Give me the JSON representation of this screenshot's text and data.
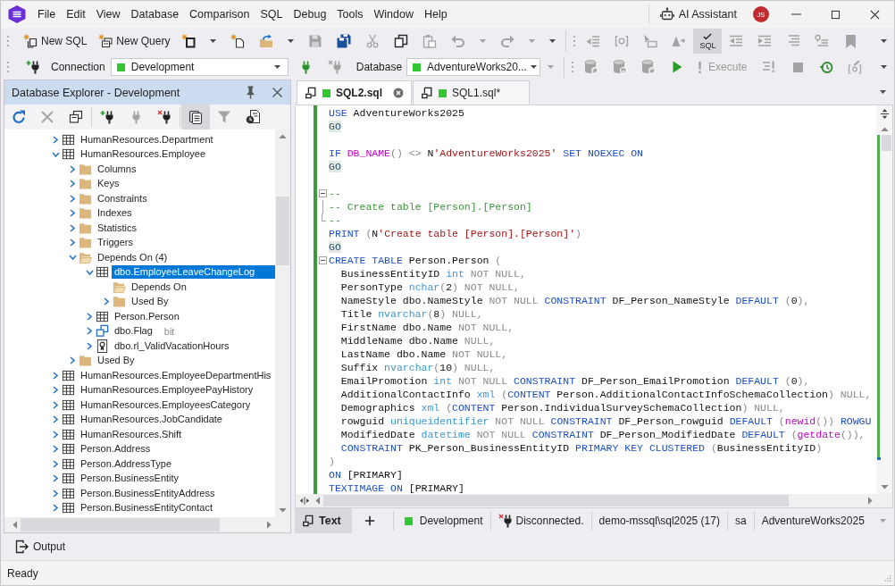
{
  "menu_bar": {
    "items": [
      "File",
      "Edit",
      "View",
      "Database",
      "Comparison",
      "SQL",
      "Debug",
      "Tools",
      "Window",
      "Help"
    ],
    "assistant": "AI Assistant",
    "avatar": "JS"
  },
  "toolbar": {
    "new_sql": {
      "label": "New SQL",
      "disabled": false
    },
    "new_query": {
      "label": "New Query",
      "disabled": false
    },
    "sql_check": {
      "label": "SQL",
      "selected": true
    }
  },
  "connection_bar": {
    "connection_label": "Connection",
    "connection": "Development",
    "database_label": "Database",
    "database": "AdventureWorks20...",
    "execute": {
      "label": "Execute",
      "disabled": true
    }
  },
  "explorer": {
    "title": "Database Explorer - Development",
    "view_toggle": {
      "selected": true
    },
    "tree": [
      {
        "label": "HumanResources.Department",
        "kind": "table",
        "expanded": false,
        "selected": false
      },
      {
        "label": "HumanResources.Employee",
        "kind": "table",
        "expanded": true,
        "selected": false,
        "children": [
          {
            "label": "Columns",
            "kind": "folder",
            "expanded": false,
            "selected": false
          },
          {
            "label": "Keys",
            "kind": "folder",
            "expanded": false,
            "selected": false
          },
          {
            "label": "Constraints",
            "kind": "folder",
            "expanded": false,
            "selected": false
          },
          {
            "label": "Indexes",
            "kind": "folder",
            "expanded": false,
            "selected": false
          },
          {
            "label": "Statistics",
            "kind": "folder",
            "expanded": false,
            "selected": false
          },
          {
            "label": "Triggers",
            "kind": "folder",
            "expanded": false,
            "selected": false
          },
          {
            "label": "Depends On (4)",
            "kind": "folder",
            "expanded": true,
            "selected": false,
            "children": [
              {
                "label": "dbo.EmployeeLeaveChangeLog",
                "kind": "table",
                "expanded": true,
                "selected": true,
                "children": [
                  {
                    "label": "Depends On",
                    "kind": "folder",
                    "expanded": true,
                    "selected": false
                  },
                  {
                    "label": "Used By",
                    "kind": "folder",
                    "expanded": false,
                    "selected": false
                  }
                ]
              },
              {
                "label": "Person.Person",
                "kind": "table",
                "expanded": false,
                "selected": false
              },
              {
                "label": "dbo.Flag",
                "detail": "bit",
                "kind": "type",
                "expanded": false,
                "selected": false
              },
              {
                "label": "dbo.rl_ValidVacationHours",
                "kind": "rule",
                "expanded": false,
                "selected": false
              }
            ]
          },
          {
            "label": "Used By",
            "kind": "folder",
            "expanded": false,
            "selected": false
          }
        ]
      },
      {
        "label": "HumanResources.EmployeeDepartmentHis",
        "kind": "table",
        "expanded": false,
        "selected": false
      },
      {
        "label": "HumanResources.EmployeePayHistory",
        "kind": "table",
        "expanded": false,
        "selected": false
      },
      {
        "label": "HumanResources.EmployeesCategory",
        "kind": "table",
        "expanded": false,
        "selected": false
      },
      {
        "label": "HumanResources.JobCandidate",
        "kind": "table",
        "expanded": false,
        "selected": false
      },
      {
        "label": "HumanResources.Shift",
        "kind": "table",
        "expanded": false,
        "selected": false
      },
      {
        "label": "Person.Address",
        "kind": "table",
        "expanded": false,
        "selected": false
      },
      {
        "label": "Person.AddressType",
        "kind": "table",
        "expanded": false,
        "selected": false
      },
      {
        "label": "Person.BusinessEntity",
        "kind": "table",
        "expanded": false,
        "selected": false
      },
      {
        "label": "Person.BusinessEntityAddress",
        "kind": "table",
        "expanded": false,
        "selected": false
      },
      {
        "label": "Person.BusinessEntityContact",
        "kind": "table",
        "expanded": false,
        "selected": false
      }
    ]
  },
  "editor": {
    "tabs": [
      {
        "label": "SQL2.sql",
        "selected": true
      },
      {
        "label": "SQL1.sql*",
        "selected": false
      }
    ],
    "lines": [
      {
        "tokens": [
          {
            "kind": "keyword",
            "text": "USE"
          },
          {
            "kind": "plain",
            "text": " AdventureWorks2025"
          }
        ]
      },
      {
        "tokens": [
          {
            "kind": "batch",
            "text": "GO"
          }
        ]
      },
      {
        "blank_before": true,
        "tokens": [
          {
            "kind": "keyword",
            "text": "IF"
          },
          {
            "kind": "function",
            "text": " DB_NAME"
          },
          {
            "kind": "operator",
            "text": "()"
          },
          {
            "kind": "operator",
            "text": " <>"
          },
          {
            "kind": "plain",
            "text": " N"
          },
          {
            "kind": "string",
            "text": "'AdventureWorks2025'"
          },
          {
            "kind": "keyword",
            "text": " SET NOEXEC ON"
          }
        ]
      },
      {
        "tokens": [
          {
            "kind": "batch",
            "text": "GO"
          }
        ]
      },
      {
        "blank_before": true,
        "expanded": true,
        "tokens": [
          {
            "kind": "comment",
            "text": "--"
          }
        ]
      },
      {
        "tokens": [
          {
            "kind": "comment",
            "text": "-- Create table [Person].[Person]"
          }
        ]
      },
      {
        "tokens": [
          {
            "kind": "comment",
            "text": "--"
          }
        ]
      },
      {
        "tokens": [
          {
            "kind": "keyword",
            "text": "PRINT"
          },
          {
            "kind": "operator",
            "text": " ("
          },
          {
            "kind": "plain",
            "text": "N"
          },
          {
            "kind": "string",
            "text": "'Create table [Person].[Person]'"
          },
          {
            "kind": "operator",
            "text": ")"
          }
        ]
      },
      {
        "tokens": [
          {
            "kind": "batch",
            "text": "GO"
          }
        ]
      },
      {
        "expanded": true,
        "tokens": [
          {
            "kind": "keyword",
            "text": "CREATE TABLE"
          },
          {
            "kind": "plain",
            "text": " Person.Person"
          },
          {
            "kind": "operator",
            "text": " ("
          }
        ]
      },
      {
        "tokens": [
          {
            "kind": "plain",
            "text": "  BusinessEntityID"
          },
          {
            "kind": "type",
            "text": " int"
          },
          {
            "kind": "operator",
            "text": " NOT NULL,"
          }
        ]
      },
      {
        "tokens": [
          {
            "kind": "plain",
            "text": "  PersonType"
          },
          {
            "kind": "type",
            "text": " nchar"
          },
          {
            "kind": "operator",
            "text": "("
          },
          {
            "kind": "plain",
            "text": "2"
          },
          {
            "kind": "operator",
            "text": ")"
          },
          {
            "kind": "operator",
            "text": " NOT NULL,"
          }
        ]
      },
      {
        "tokens": [
          {
            "kind": "plain",
            "text": "  NameStyle dbo.NameStyle"
          },
          {
            "kind": "operator",
            "text": " NOT NULL"
          },
          {
            "kind": "keyword",
            "text": " CONSTRAINT"
          },
          {
            "kind": "plain",
            "text": " DF_Person_NameStyle"
          },
          {
            "kind": "keyword",
            "text": " DEFAULT"
          },
          {
            "kind": "operator",
            "text": " ("
          },
          {
            "kind": "plain",
            "text": "0"
          },
          {
            "kind": "operator",
            "text": "),"
          }
        ]
      },
      {
        "tokens": [
          {
            "kind": "plain",
            "text": "  Title"
          },
          {
            "kind": "type",
            "text": " nvarchar"
          },
          {
            "kind": "operator",
            "text": "("
          },
          {
            "kind": "plain",
            "text": "8"
          },
          {
            "kind": "operator",
            "text": ")"
          },
          {
            "kind": "operator",
            "text": " NULL,"
          }
        ]
      },
      {
        "tokens": [
          {
            "kind": "plain",
            "text": "  FirstName dbo.Name"
          },
          {
            "kind": "operator",
            "text": " NOT NULL,"
          }
        ]
      },
      {
        "tokens": [
          {
            "kind": "plain",
            "text": "  MiddleName dbo.Name"
          },
          {
            "kind": "operator",
            "text": " NULL,"
          }
        ]
      },
      {
        "tokens": [
          {
            "kind": "plain",
            "text": "  LastName dbo.Name"
          },
          {
            "kind": "operator",
            "text": " NOT NULL,"
          }
        ]
      },
      {
        "tokens": [
          {
            "kind": "plain",
            "text": "  Suffix"
          },
          {
            "kind": "type",
            "text": " nvarchar"
          },
          {
            "kind": "operator",
            "text": "("
          },
          {
            "kind": "plain",
            "text": "10"
          },
          {
            "kind": "operator",
            "text": ")"
          },
          {
            "kind": "operator",
            "text": " NULL,"
          }
        ]
      },
      {
        "tokens": [
          {
            "kind": "plain",
            "text": "  EmailPromotion"
          },
          {
            "kind": "type",
            "text": " int"
          },
          {
            "kind": "operator",
            "text": " NOT NULL"
          },
          {
            "kind": "keyword",
            "text": " CONSTRAINT"
          },
          {
            "kind": "plain",
            "text": " DF_Person_EmailPromotion"
          },
          {
            "kind": "keyword",
            "text": " DEFAULT"
          },
          {
            "kind": "operator",
            "text": " ("
          },
          {
            "kind": "plain",
            "text": "0"
          },
          {
            "kind": "operator",
            "text": "),"
          }
        ]
      },
      {
        "tokens": [
          {
            "kind": "plain",
            "text": "  AdditionalContactInfo"
          },
          {
            "kind": "type",
            "text": " xml"
          },
          {
            "kind": "operator",
            "text": " ("
          },
          {
            "kind": "keyword",
            "text": "CONTENT"
          },
          {
            "kind": "plain",
            "text": " Person.AdditionalContactInfoSchemaCollection"
          },
          {
            "kind": "operator",
            "text": ")"
          },
          {
            "kind": "operator",
            "text": " NULL,"
          }
        ]
      },
      {
        "tokens": [
          {
            "kind": "plain",
            "text": "  Demographics"
          },
          {
            "kind": "type",
            "text": " xml"
          },
          {
            "kind": "operator",
            "text": " ("
          },
          {
            "kind": "keyword",
            "text": "CONTENT"
          },
          {
            "kind": "plain",
            "text": " Person.IndividualSurveySchemaCollection"
          },
          {
            "kind": "operator",
            "text": ")"
          },
          {
            "kind": "operator",
            "text": " NULL,"
          }
        ]
      },
      {
        "tokens": [
          {
            "kind": "plain",
            "text": "  rowguid"
          },
          {
            "kind": "type",
            "text": " uniqueidentifier"
          },
          {
            "kind": "operator",
            "text": " NOT NULL"
          },
          {
            "kind": "keyword",
            "text": " CONSTRAINT"
          },
          {
            "kind": "plain",
            "text": " DF_Person_rowguid"
          },
          {
            "kind": "keyword",
            "text": " DEFAULT"
          },
          {
            "kind": "operator",
            "text": " ("
          },
          {
            "kind": "function",
            "text": "newid"
          },
          {
            "kind": "operator",
            "text": "())"
          },
          {
            "kind": "keyword",
            "text": " ROWGU"
          }
        ]
      },
      {
        "tokens": [
          {
            "kind": "plain",
            "text": "  ModifiedDate"
          },
          {
            "kind": "type",
            "text": " datetime"
          },
          {
            "kind": "operator",
            "text": " NOT NULL"
          },
          {
            "kind": "keyword",
            "text": " CONSTRAINT"
          },
          {
            "kind": "plain",
            "text": " DF_Person_ModifiedDate"
          },
          {
            "kind": "keyword",
            "text": " DEFAULT"
          },
          {
            "kind": "operator",
            "text": " ("
          },
          {
            "kind": "function",
            "text": "getdate"
          },
          {
            "kind": "operator",
            "text": "()),"
          }
        ]
      },
      {
        "tokens": [
          {
            "kind": "keyword",
            "text": "  CONSTRAINT"
          },
          {
            "kind": "plain",
            "text": " PK_Person_BusinessEntityID"
          },
          {
            "kind": "keyword",
            "text": " PRIMARY KEY CLUSTERED"
          },
          {
            "kind": "operator",
            "text": " ("
          },
          {
            "kind": "plain",
            "text": "BusinessEntityID"
          },
          {
            "kind": "operator",
            "text": ")"
          }
        ]
      },
      {
        "tokens": [
          {
            "kind": "operator",
            "text": ")"
          }
        ]
      },
      {
        "tokens": [
          {
            "kind": "keyword",
            "text": "ON"
          },
          {
            "kind": "plain",
            "text": " [PRIMARY]"
          }
        ]
      },
      {
        "tokens": [
          {
            "kind": "keyword",
            "text": "TEXTIMAGE ON"
          },
          {
            "kind": "plain",
            "text": " [PRIMARY]"
          }
        ]
      }
    ],
    "status_bar": {
      "mode": {
        "label": "Text",
        "selected": true
      },
      "connection": "Development",
      "state": "Disconnected.",
      "server": "demo-mssql\\sql2025 (17)",
      "user": "sa",
      "database": "AdventureWorks2025"
    }
  },
  "output_tab": "Output",
  "status_bar": {
    "text": "Ready"
  }
}
